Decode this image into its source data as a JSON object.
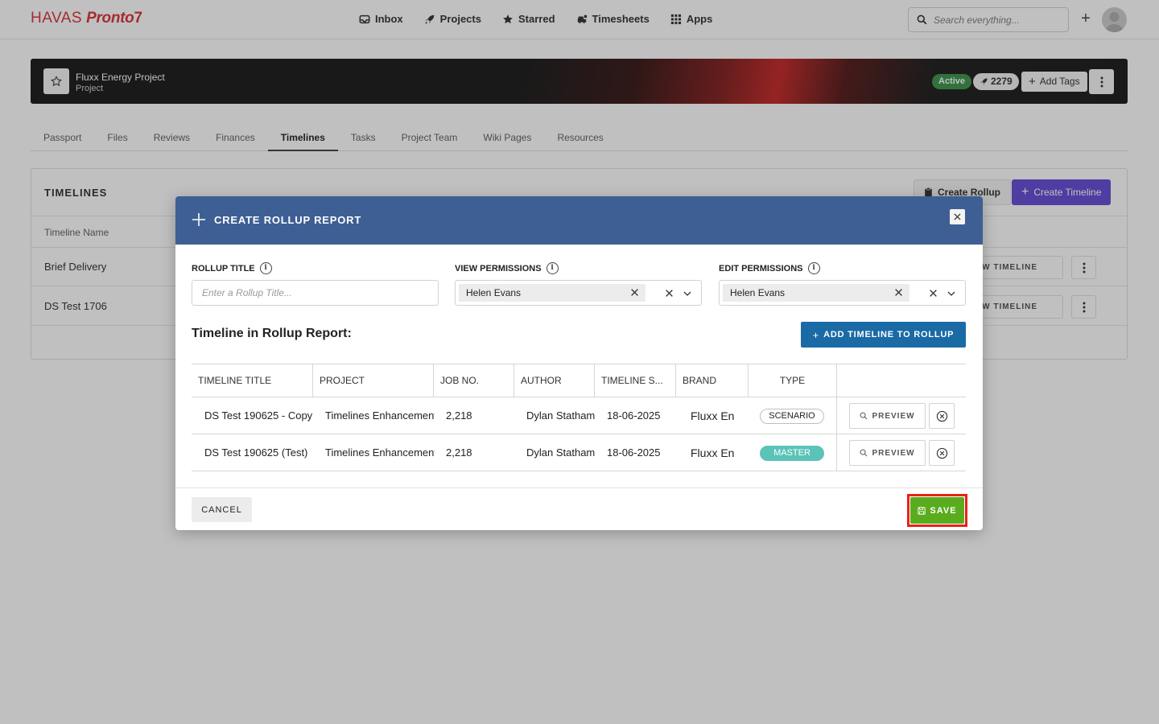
{
  "nav": {
    "logo_part1": "HAVAS",
    "logo_part2": "Pronto",
    "logo_part3": "7",
    "items": [
      {
        "label": "Inbox",
        "icon": "inbox-icon"
      },
      {
        "label": "Projects",
        "icon": "rocket-icon"
      },
      {
        "label": "Starred",
        "icon": "star-icon"
      },
      {
        "label": "Timesheets",
        "icon": "car-icon"
      },
      {
        "label": "Apps",
        "icon": "grid-icon"
      }
    ],
    "search_placeholder": "Search everything...",
    "plus_label": "+"
  },
  "project": {
    "title": "Fluxx Energy Project",
    "subtitle": "Project",
    "status": "Active",
    "count": "2279",
    "add_tags": "Add Tags"
  },
  "tabs": [
    "Passport",
    "Files",
    "Reviews",
    "Finances",
    "Timelines",
    "Tasks",
    "Project Team",
    "Wiki Pages",
    "Resources"
  ],
  "active_tab": "Timelines",
  "timelines_card": {
    "title": "TIMELINES",
    "create_rollup": "Create Rollup",
    "create_timeline": "Create Timeline",
    "col_name": "Timeline Name",
    "rows": [
      {
        "name": "Brief Delivery",
        "action": "VIEW TIMELINE"
      },
      {
        "name": "DS Test 1706",
        "action": "VIEW TIMELINE"
      }
    ]
  },
  "modal": {
    "title": "CREATE ROLLUP REPORT",
    "rollup_title_label": "ROLLUP TITLE",
    "rollup_title_placeholder": "Enter a Rollup Title...",
    "rollup_title_value": "",
    "view_permissions_label": "VIEW PERMISSIONS",
    "view_permissions_value": "Helen Evans",
    "edit_permissions_label": "EDIT PERMISSIONS",
    "edit_permissions_value": "Helen Evans",
    "section_title": "Timeline in Rollup Report:",
    "add_timeline": "ADD TIMELINE TO ROLLUP",
    "columns": [
      "TIMELINE TITLE",
      "PROJECT",
      "JOB NO.",
      "AUTHOR",
      "TIMELINE S...",
      "BRAND",
      "TYPE"
    ],
    "rows": [
      {
        "title": "DS Test 190625 - Copy",
        "project": "Timelines Enhancement",
        "job": "2,218",
        "author": "Dylan Statham",
        "start": "18-06-2025",
        "brand": "Fluxx En",
        "type": "SCENARIO",
        "preview": "PREVIEW"
      },
      {
        "title": "DS Test 190625 (Test)",
        "project": "Timelines Enhancement",
        "job": "2,218",
        "author": "Dylan Statham",
        "start": "18-06-2025",
        "brand": "Fluxx En",
        "type": "MASTER",
        "preview": "PREVIEW"
      }
    ],
    "cancel": "CANCEL",
    "save": "SAVE"
  },
  "colors": {
    "brand_red": "#d6262b",
    "modal_header": "#3e5f94",
    "primary_blue": "#1a6aa6",
    "save_green": "#5aac1f",
    "master_teal": "#5cc3b9",
    "create_timeline_purple": "#5b3fd1",
    "highlight_red": "#e8231a"
  }
}
